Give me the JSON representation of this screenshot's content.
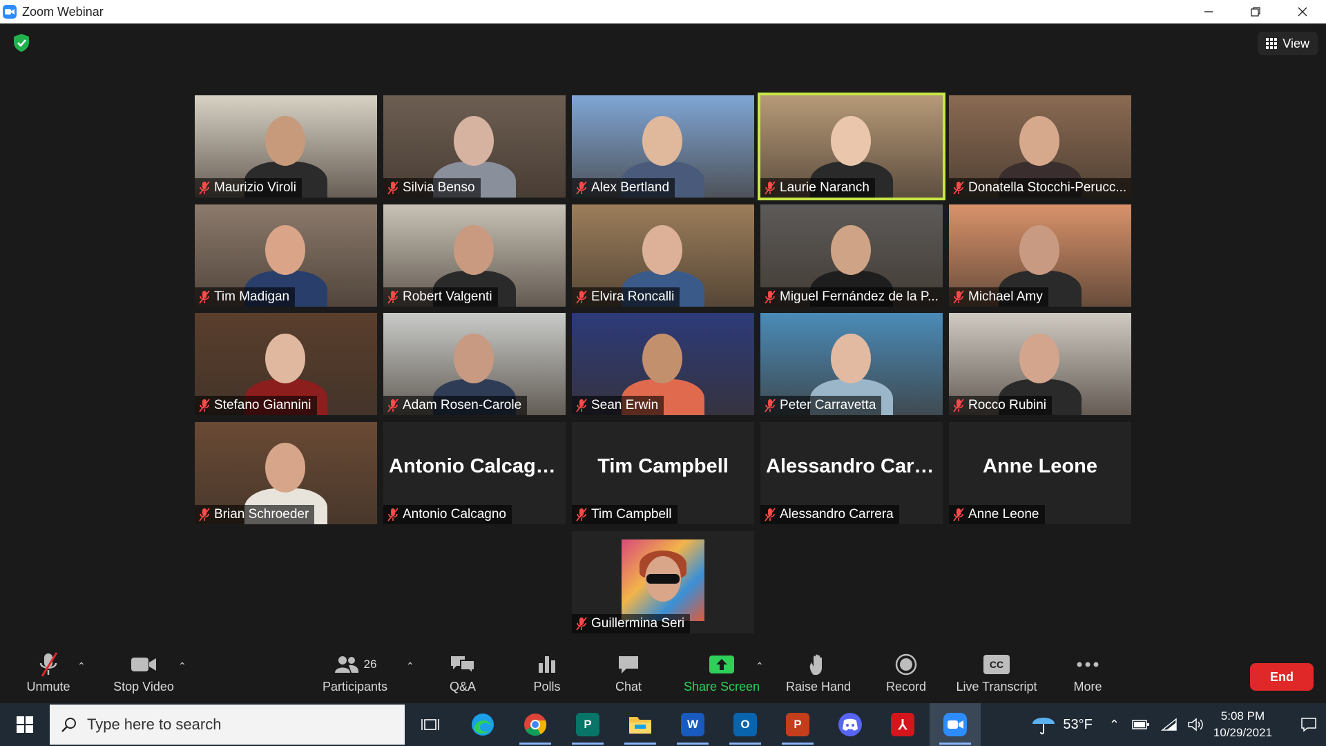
{
  "window": {
    "title": "Zoom Webinar"
  },
  "top": {
    "view_label": "View"
  },
  "tiles": [
    {
      "name": "Maurizio Viroli",
      "video": true,
      "active": false,
      "bg": "#d8d2c5",
      "skin": "#c79a7c",
      "shirt": "#2b2b2b"
    },
    {
      "name": "Silvia Benso",
      "video": true,
      "active": false,
      "bg": "#6d5e52",
      "skin": "#d6b3a0",
      "shirt": "#8a8f9c"
    },
    {
      "name": "Alex Bertland",
      "video": true,
      "active": false,
      "bg": "#7fa6d6",
      "skin": "#e0b89c",
      "shirt": "#4a5a7a"
    },
    {
      "name": "Laurie Naranch",
      "video": true,
      "active": true,
      "bg": "#b79a78",
      "skin": "#eac6ad",
      "shirt": "#2a2a2a"
    },
    {
      "name": "Donatella Stocchi-Perucc...",
      "video": true,
      "active": false,
      "bg": "#8a6a52",
      "skin": "#d7a98c",
      "shirt": "#3b2e2e"
    },
    {
      "name": "Tim Madigan",
      "video": true,
      "active": false,
      "bg": "#8c7a6c",
      "skin": "#d9a487",
      "shirt": "#2a3e6b"
    },
    {
      "name": "Robert Valgenti",
      "video": true,
      "active": false,
      "bg": "#c8c2b6",
      "skin": "#c99a7f",
      "shirt": "#2a2a2a"
    },
    {
      "name": "Elvira Roncalli",
      "video": true,
      "active": false,
      "bg": "#9c7e5a",
      "skin": "#dcb197",
      "shirt": "#3a5a8a"
    },
    {
      "name": "Miguel Fernández de la P...",
      "video": true,
      "active": false,
      "bg": "#5c5a58",
      "skin": "#cfa386",
      "shirt": "#1e1e1e"
    },
    {
      "name": "Michael Amy",
      "video": true,
      "active": false,
      "bg": "#d9926a",
      "skin": "#c99a82",
      "shirt": "#2a2a2a"
    },
    {
      "name": "Stefano Giannini",
      "video": true,
      "active": false,
      "bg": "#5a3e2c",
      "skin": "#e0b8a0",
      "shirt": "#8c1e1e"
    },
    {
      "name": "Adam Rosen-Carole",
      "video": true,
      "active": false,
      "bg": "#c9cbc8",
      "skin": "#c89a82",
      "shirt": "#2f3c55"
    },
    {
      "name": "Sean Erwin",
      "video": true,
      "active": false,
      "bg": "#2c3a7a",
      "skin": "#c3906e",
      "shirt": "#e06a4e"
    },
    {
      "name": "Peter Carravetta",
      "video": true,
      "active": false,
      "bg": "#4a8bb8",
      "skin": "#e2b9a1",
      "shirt": "#9ab6c8"
    },
    {
      "name": "Rocco Rubini",
      "video": true,
      "active": false,
      "bg": "#cfcac2",
      "skin": "#d3a58c",
      "shirt": "#2a2a2a"
    },
    {
      "name": "Brian Schroeder",
      "video": true,
      "active": false,
      "bg": "#6a4a34",
      "skin": "#d6a58a",
      "shirt": "#e8e4dc"
    },
    {
      "name": "Antonio Calcagno",
      "video": false,
      "active": false,
      "big": "Antonio Calcagno"
    },
    {
      "name": "Tim Campbell",
      "video": false,
      "active": false,
      "big": "Tim Campbell"
    },
    {
      "name": "Alessandro Carrera",
      "video": false,
      "active": false,
      "big": "Alessandro  Carr..."
    },
    {
      "name": "Anne Leone",
      "video": false,
      "active": false,
      "big": "Anne Leone"
    },
    {
      "name": "Guillermina Seri",
      "video": false,
      "active": false,
      "avatar": true
    }
  ],
  "toolbar": {
    "unmute": "Unmute",
    "stop_video": "Stop Video",
    "participants": "Participants",
    "participants_count": "26",
    "qa": "Q&A",
    "polls": "Polls",
    "chat": "Chat",
    "share_screen": "Share Screen",
    "raise_hand": "Raise Hand",
    "record": "Record",
    "live_transcript": "Live Transcript",
    "more": "More",
    "end": "End",
    "cc_badge": "CC"
  },
  "taskbar": {
    "search_placeholder": "Type here to search",
    "apps": [
      "task-view",
      "edge",
      "chrome",
      "publisher",
      "file-explorer",
      "word",
      "outlook",
      "powerpoint",
      "discord",
      "acrobat",
      "zoom"
    ],
    "weather": "53°F",
    "time": "5:08 PM",
    "date": "10/29/2021"
  },
  "colors": {
    "active_speaker": "#c7e845",
    "share_green": "#2fd05a",
    "end_red": "#e02828",
    "zoom_blue": "#2d8cff"
  }
}
